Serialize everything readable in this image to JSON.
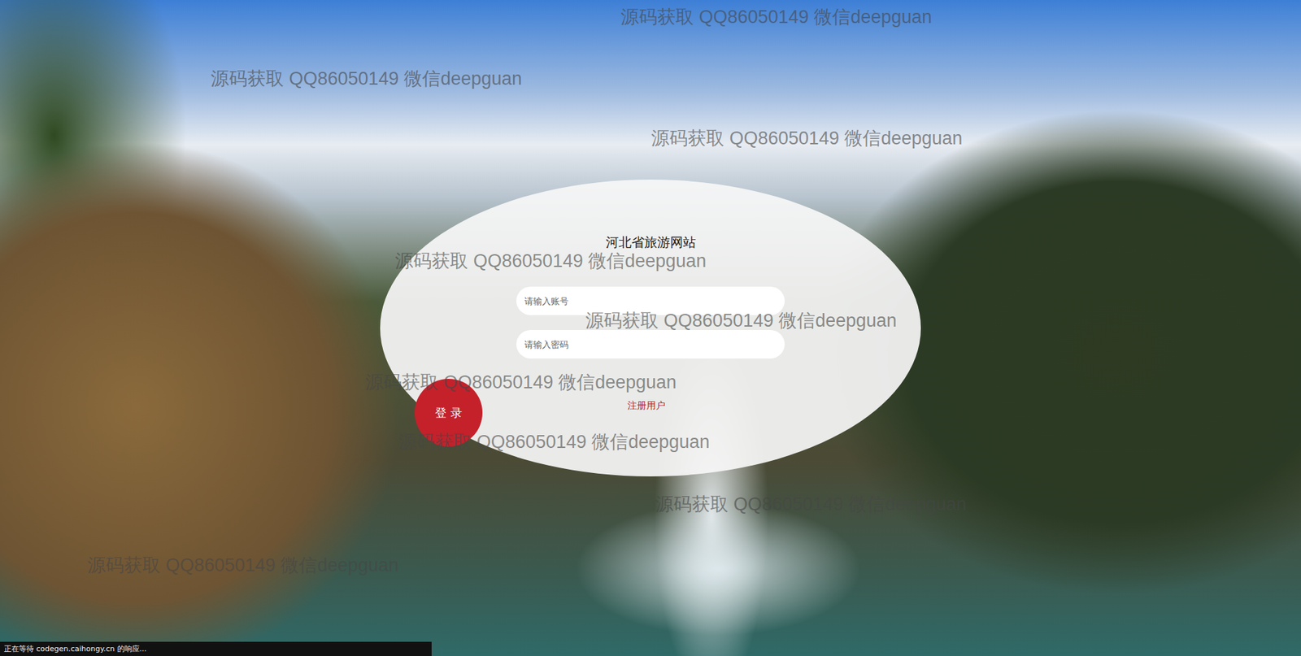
{
  "page": {
    "title": "河北省旅游网站"
  },
  "form": {
    "fields": [
      {
        "placeholder": "请输入账号",
        "kind": "text"
      },
      {
        "placeholder": "请输入密码",
        "kind": "password"
      }
    ],
    "login_button": "登 录",
    "register_link": "注册用户"
  },
  "watermarks": [
    "源码获取 QQ86050149 微信deepguan",
    "源码获取 QQ86050149 微信deepguan",
    "源码获取 QQ86050149 微信deepguan",
    "源码获取 QQ86050149 微信deepguan",
    "源码获取 QQ86050149 微信deepguan",
    "源码获取 QQ86050149 微信deepguan",
    "源码获取 QQ86050149 微信deepguan",
    "源码获取 QQ86050149 微信deepguan",
    "源码获取 QQ86050149 微信deepguan"
  ],
  "status_bar": "正在等待 codegen.caihongy.cn 的响应..."
}
